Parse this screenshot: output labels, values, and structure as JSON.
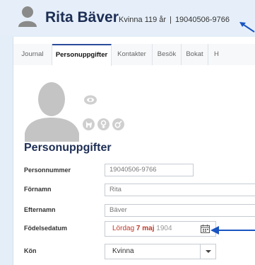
{
  "header": {
    "name": "Rita Bäver",
    "gender_age": "Kvinna 119 år",
    "separator": "|",
    "personnummer": "19040506-9766"
  },
  "tabs": [
    {
      "label": "Journal"
    },
    {
      "label": "Personuppgifter",
      "active": true
    },
    {
      "label": "Kontakter"
    },
    {
      "label": "Besök"
    },
    {
      "label": "Bokat"
    },
    {
      "label": "H"
    }
  ],
  "section": {
    "title": "Personuppgifter"
  },
  "fields": {
    "personnummer": {
      "label": "Personnummer",
      "value": "19040506-9766"
    },
    "fornamn": {
      "label": "Förnamn",
      "value": "Rita"
    },
    "efternamn": {
      "label": "Efternamn",
      "value": "Bäver"
    },
    "fodelsedatum": {
      "label": "Födelsedatum",
      "weekday": "Lördag",
      "day_month": "7 maj",
      "year": "1904"
    },
    "kon": {
      "label": "Kön",
      "value": "Kvinna"
    }
  },
  "icons": [
    "person-avatar-icon",
    "eye-icon",
    "dog-icon",
    "female-symbol-icon",
    "male-symbol-icon",
    "calendar-icon",
    "chevron-down-icon",
    "arrow-icon"
  ],
  "colors": {
    "brand": "#1d2e55",
    "accent_tab": "#2b4d9c",
    "date_text": "#c0392b",
    "annotation_arrow": "#1a55c2",
    "header_bg": "#e6eff9"
  }
}
